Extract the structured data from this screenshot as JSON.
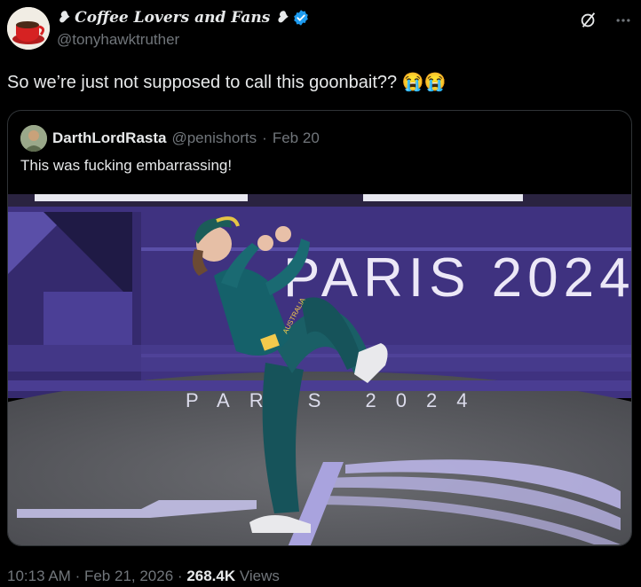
{
  "author": {
    "display_name": "❥ Coffee Lovers and Fans ❥",
    "handle": "@tonyhawktruther",
    "verified": true
  },
  "tweet_text": "So we’re just not supposed to call this goonbait?? 😭😭",
  "quoted": {
    "display_name": "DarthLordRasta",
    "handle": "@penishorts",
    "separator": "·",
    "date": "Feb 20",
    "text": "This was fucking embarrassing!",
    "image": {
      "banner_text": "PARIS 2024",
      "floor_text": "PARIS 2024",
      "jersey_text": "AUSTRALIA"
    }
  },
  "footer": {
    "time": "10:13 AM",
    "separator": "·",
    "date": "Feb 21, 2026",
    "views_count": "268.4K",
    "views_label": "Views"
  },
  "icons": [
    "grok-icon",
    "more-icon",
    "verified-badge-icon"
  ],
  "colors": {
    "background": "#000000",
    "text": "#e7e9ea",
    "muted": "#71767b",
    "verified": "#1d9bf0",
    "border": "#2f3336",
    "banner_purple": "#4a3a8a"
  }
}
